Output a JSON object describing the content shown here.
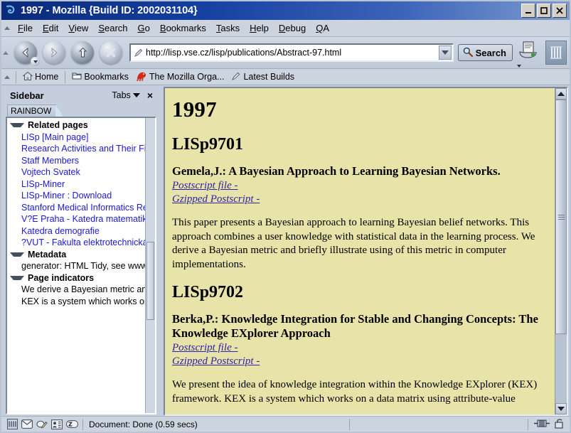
{
  "window": {
    "title": "1997 - Mozilla {Build ID: 2002031104}",
    "icon": "mozilla-dino-icon",
    "controls": {
      "minimize": "minimize-icon",
      "maximize": "maximize-icon",
      "close": "close-icon"
    }
  },
  "menubar": {
    "items": [
      {
        "label": "File",
        "accesskey": "F"
      },
      {
        "label": "Edit",
        "accesskey": "E"
      },
      {
        "label": "View",
        "accesskey": "V"
      },
      {
        "label": "Search",
        "accesskey": "S"
      },
      {
        "label": "Go",
        "accesskey": "G"
      },
      {
        "label": "Bookmarks",
        "accesskey": "B"
      },
      {
        "label": "Tasks",
        "accesskey": "T"
      },
      {
        "label": "Help",
        "accesskey": "H"
      },
      {
        "label": "Debug",
        "accesskey": "D"
      },
      {
        "label": "QA",
        "accesskey": "Q"
      }
    ]
  },
  "navbar": {
    "back": "back-arrow-icon",
    "forward": "forward-arrow-icon",
    "reload": "reload-icon",
    "stop": "stop-icon",
    "url_value": "http://lisp.vse.cz/lisp/publications/Abstract-97.html",
    "url_icon": "page-pencil-icon",
    "url_dropdown": "chevron-down-icon",
    "search_label": "Search",
    "search_icon": "magnifier-icon",
    "print_icon": "print-icon",
    "brand_icon": "mozilla-m-icon"
  },
  "personalbar": {
    "items": [
      {
        "label": "Home",
        "icon": "home-icon"
      },
      {
        "label": "Bookmarks",
        "icon": "folder-icon"
      },
      {
        "label": "The Mozilla Orga...",
        "icon": "mozilla-lizard-icon"
      },
      {
        "label": "Latest Builds",
        "icon": "bookmark-pencil-icon"
      }
    ]
  },
  "sidebar": {
    "title": "Sidebar",
    "tabs_label": "Tabs",
    "close_label": "×",
    "active_tab": "RAINBOW",
    "groups": [
      {
        "label": "Related pages",
        "items": [
          {
            "text": "LISp [Main page]",
            "type": "link"
          },
          {
            "text": "Research Activities and Their Fin",
            "type": "link"
          },
          {
            "text": "Staff Members",
            "type": "link"
          },
          {
            "text": "Vojtech Svatek",
            "type": "link"
          },
          {
            "text": "LISp-Miner",
            "type": "link"
          },
          {
            "text": "LISp-Miner : Download",
            "type": "link"
          },
          {
            "text": "Stanford Medical Informatics Rep",
            "type": "link"
          },
          {
            "text": "V?E Praha - Katedra matematiky",
            "type": "link"
          },
          {
            "text": "Katedra demografie",
            "type": "link"
          },
          {
            "text": "?VUT - Fakulta elektrotechnická",
            "type": "link"
          }
        ]
      },
      {
        "label": "Metadata",
        "items": [
          {
            "text": "generator: HTML Tidy, see www",
            "type": "plain"
          }
        ]
      },
      {
        "label": "Page indicators",
        "items": [
          {
            "text": "We derive a Bayesian metric and",
            "type": "plain"
          },
          {
            "text": "KEX is a system which works on",
            "type": "plain"
          }
        ]
      }
    ]
  },
  "page": {
    "heading": "1997",
    "entries": [
      {
        "id": "LISp9701",
        "title": "Gemela,J.: A Bayesian Approach to Learning Bayesian Networks.",
        "links": [
          "Postscript file -",
          "Gzipped Postscript -"
        ],
        "abstract": "This paper presents a Bayesian approach to learning Bayesian belief networks. This approach combines a user knowledge with statistical data in the learning process. We derive a Bayesian metric and briefly illustrate using of this metric in computer implementations."
      },
      {
        "id": "LISp9702",
        "title": "Berka,P.: Knowledge Integration for Stable and Changing Concepts: The Knowledge EXplorer Approach",
        "links": [
          "Postscript file -",
          "Gzipped Postscript -"
        ],
        "abstract": "We present the idea of knowledge integration within the Knowledge EXplorer (KEX) framework. KEX is a system which works on a data matrix using attribute-value"
      }
    ]
  },
  "statusbar": {
    "icons": [
      "mozilla-m-icon",
      "mail-icon",
      "compose-icon",
      "addressbook-icon",
      "composer-icon"
    ],
    "message": "Document: Done (0.59 secs)",
    "right_icons": [
      "offline-icon",
      "security-lock-icon"
    ]
  },
  "colors": {
    "title_bar_start": "#0a2a7a",
    "chrome": "#ccd4e0",
    "page_background": "#e8e3a9",
    "link": "#1a19d6",
    "page_link": "#2e22a6"
  }
}
